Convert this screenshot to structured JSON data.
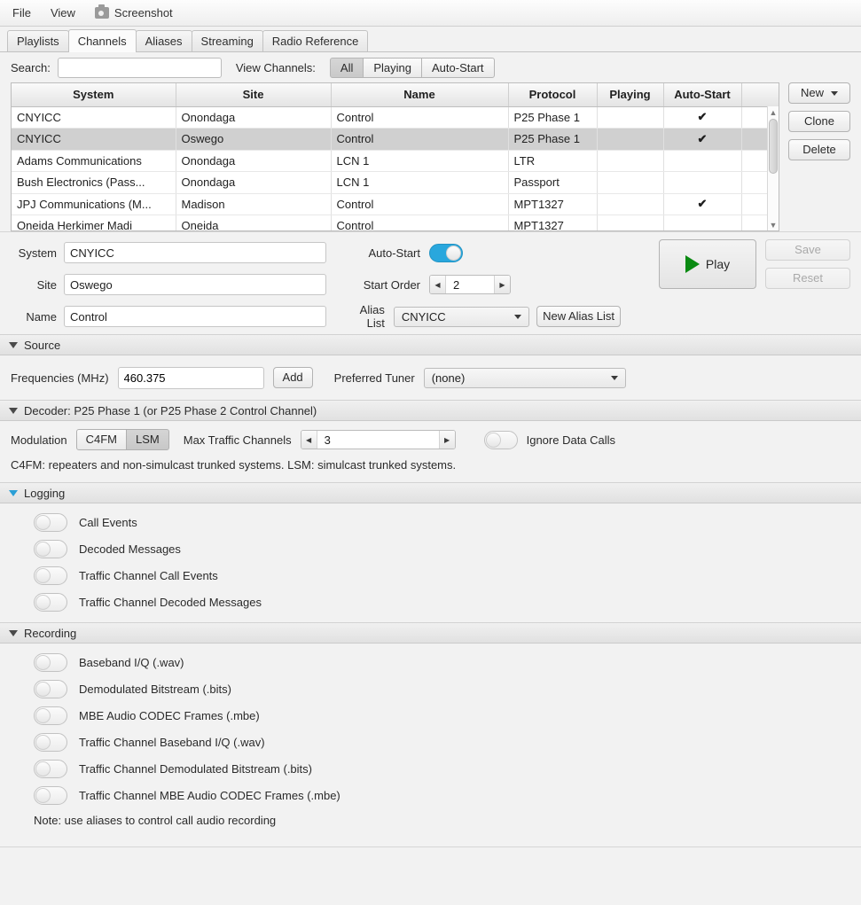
{
  "menubar": {
    "items": [
      {
        "label": "File",
        "icon": null
      },
      {
        "label": "View",
        "icon": null
      },
      {
        "label": "Screenshot",
        "icon": "camera-icon"
      }
    ]
  },
  "tabs": [
    {
      "label": "Playlists",
      "active": false
    },
    {
      "label": "Channels",
      "active": true
    },
    {
      "label": "Aliases",
      "active": false
    },
    {
      "label": "Streaming",
      "active": false
    },
    {
      "label": "Radio Reference",
      "active": false
    }
  ],
  "search": {
    "label": "Search:",
    "value": "",
    "placeholder": ""
  },
  "view_channels": {
    "label": "View Channels:",
    "options": [
      "All",
      "Playing",
      "Auto-Start"
    ],
    "selected": "All"
  },
  "table": {
    "columns": [
      "System",
      "Site",
      "Name",
      "Protocol",
      "Playing",
      "Auto-Start",
      ""
    ],
    "rows": [
      {
        "system": "CNYICC",
        "site": "Onondaga",
        "name": "Control",
        "protocol": "P25 Phase 1",
        "playing": "",
        "auto_start": "✔",
        "extra": "",
        "selected": false
      },
      {
        "system": "CNYICC",
        "site": "Oswego",
        "name": "Control",
        "protocol": "P25 Phase 1",
        "playing": "",
        "auto_start": "✔",
        "extra": "",
        "selected": true
      },
      {
        "system": "Adams Communications",
        "site": "Onondaga",
        "name": "LCN 1",
        "protocol": "LTR",
        "playing": "",
        "auto_start": "",
        "extra": "",
        "selected": false
      },
      {
        "system": "Bush Electronics (Pass...",
        "site": "Onondaga",
        "name": "LCN 1",
        "protocol": "Passport",
        "playing": "",
        "auto_start": "",
        "extra": "",
        "selected": false
      },
      {
        "system": "JPJ Communications (M...",
        "site": "Madison",
        "name": "Control",
        "protocol": "MPT1327",
        "playing": "",
        "auto_start": "✔",
        "extra": "",
        "selected": false
      },
      {
        "system": "Oneida Herkimer Madi",
        "site": "Oneida",
        "name": "Control",
        "protocol": "MPT1327",
        "playing": "",
        "auto_start": "",
        "extra": "",
        "selected": false
      }
    ]
  },
  "side_buttons": {
    "new_label": "New",
    "clone_label": "Clone",
    "delete_label": "Delete"
  },
  "form": {
    "system_label": "System",
    "system_value": "CNYICC",
    "site_label": "Site",
    "site_value": "Oswego",
    "name_label": "Name",
    "name_value": "Control",
    "auto_start_label": "Auto-Start",
    "auto_start_on": true,
    "start_order_label": "Start Order",
    "start_order_value": "2",
    "alias_list_label": "Alias List",
    "alias_list_value": "CNYICC",
    "new_alias_list_label": "New Alias List",
    "play_label": "Play",
    "save_label": "Save",
    "reset_label": "Reset"
  },
  "source": {
    "title": "Source",
    "frequencies_label": "Frequencies (MHz)",
    "frequencies_value": "460.375",
    "add_label": "Add",
    "preferred_tuner_label": "Preferred Tuner",
    "preferred_tuner_value": "(none)"
  },
  "decoder": {
    "title": "Decoder: P25 Phase 1 (or P25 Phase 2 Control Channel)",
    "modulation_label": "Modulation",
    "modulation_options": [
      "C4FM",
      "LSM"
    ],
    "modulation_selected": "LSM",
    "max_traffic_channels_label": "Max Traffic Channels",
    "max_traffic_channels_value": "3",
    "ignore_data_calls_label": "Ignore Data Calls",
    "ignore_data_calls_on": false,
    "hint": "C4FM: repeaters and non-simulcast trunked systems.  LSM: simulcast trunked systems."
  },
  "logging": {
    "title": "Logging",
    "toggles": [
      {
        "label": "Call Events",
        "on": false
      },
      {
        "label": "Decoded Messages",
        "on": false
      },
      {
        "label": "Traffic Channel Call Events",
        "on": false
      },
      {
        "label": "Traffic Channel Decoded Messages",
        "on": false
      }
    ]
  },
  "recording": {
    "title": "Recording",
    "toggles": [
      {
        "label": "Baseband I/Q (.wav)",
        "on": false
      },
      {
        "label": "Demodulated Bitstream (.bits)",
        "on": false
      },
      {
        "label": "MBE Audio CODEC Frames (.mbe)",
        "on": false
      },
      {
        "label": "Traffic Channel Baseband I/Q (.wav)",
        "on": false
      },
      {
        "label": "Traffic Channel Demodulated Bitstream (.bits)",
        "on": false
      },
      {
        "label": "Traffic Channel MBE Audio CODEC Frames (.mbe)",
        "on": false
      }
    ],
    "note": "Note: use aliases to control call audio recording"
  },
  "colors": {
    "toggle_on": "#29a7dd",
    "check_green": "#0d8a24",
    "play_green": "#0a8a12",
    "selected_row": "#d0d0d0",
    "section_triangle_active": "#2a9fd6"
  }
}
